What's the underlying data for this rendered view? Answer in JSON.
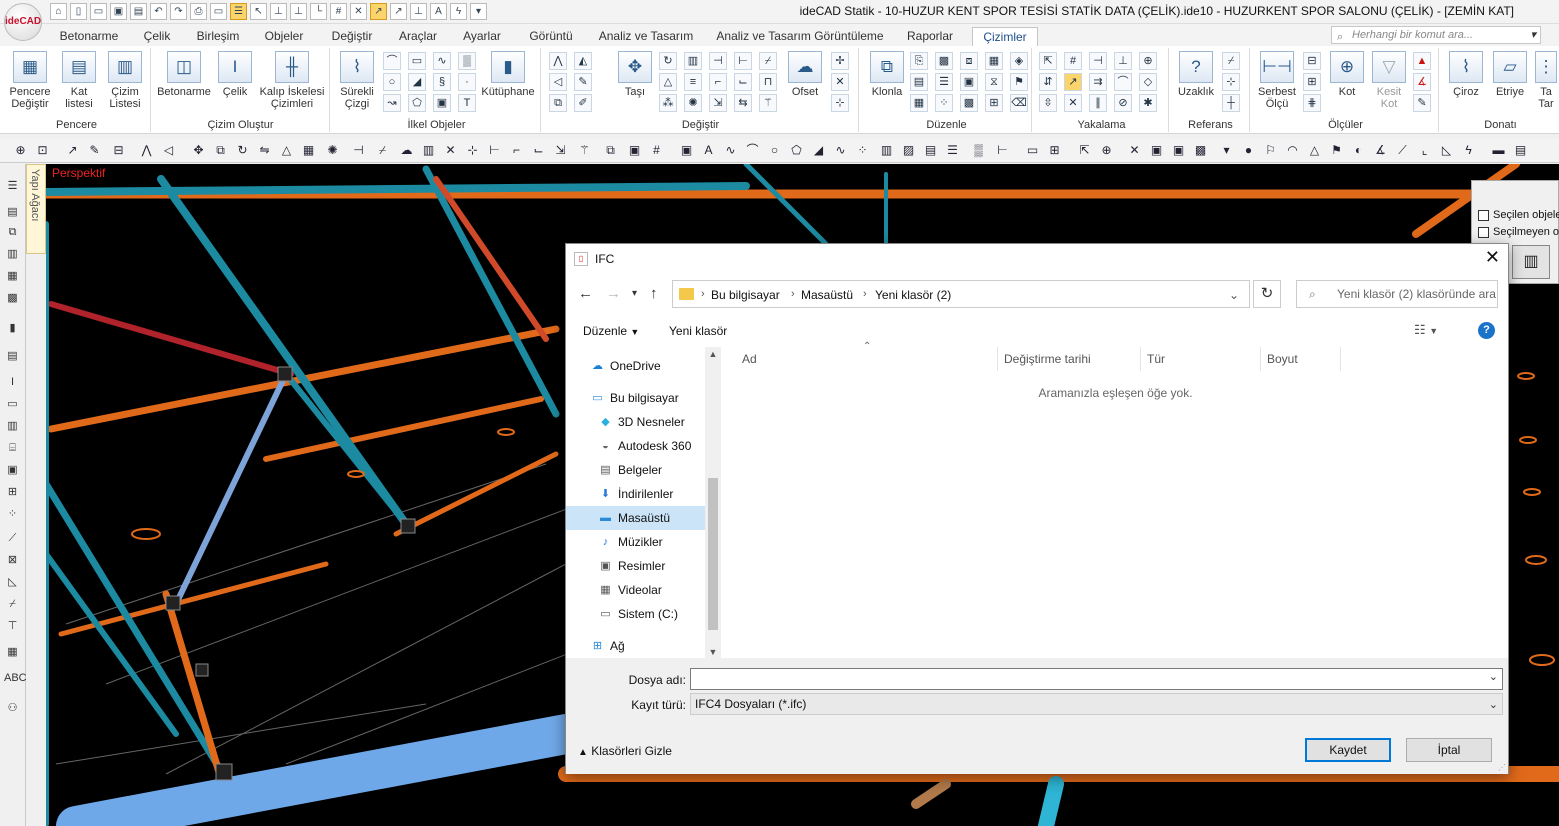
{
  "app": {
    "logo_text": "ideCAD",
    "window_title": "ideCAD Statik - 10-HUZUR KENT SPOR TESİSİ STATİK DATA (ÇELİK).ide10 - HUZURKENT SPOR SALONU (ÇELİK) - [ZEMİN KAT]"
  },
  "ribbon_tabs": [
    "Betonarme",
    "Çelik",
    "Birleşim",
    "Objeler",
    "Değiştir",
    "Araçlar",
    "Ayarlar",
    "Görüntü",
    "Analiz ve Tasarım",
    "Analiz ve Tasarım Görüntüleme",
    "Raporlar",
    "Çizimler"
  ],
  "active_tab": "Çizimler",
  "command_search_placeholder": "Herhangi bir komut ara...",
  "ribbon_groups": {
    "pencere": {
      "label": "Pencere",
      "btn1": "Pencere Değiştir",
      "btn2": "Kat listesi",
      "btn3": "Çizim Listesi"
    },
    "cizim_olustur": {
      "label": "Çizim Oluştur",
      "btn1": "Betonarme",
      "btn2": "Çelik",
      "btn3": "Kalıp İskelesi Çizimleri"
    },
    "ilkel": {
      "label": "İlkel Objeler",
      "btn1": "Sürekli Çizgi",
      "btn2": "Kütüphane"
    },
    "degistir": {
      "label": "Değiştir",
      "btn1": "Taşı",
      "btn2": "Ofset"
    },
    "duzenle": {
      "label": "Düzenle",
      "btn1": "Klonla"
    },
    "yakalama": {
      "label": "Yakalama"
    },
    "referans": {
      "label": "Referans",
      "btn1": "Uzaklık"
    },
    "olculer": {
      "label": "Ölçüler",
      "btn1": "Serbest Ölçü",
      "btn2": "Kot",
      "btn3": "Kesit Kot"
    },
    "donati": {
      "label": "Donatı",
      "btn1": "Çiroz",
      "btn2": "Etriye",
      "btn3": "Ta Tar"
    }
  },
  "side_panel_label": "Yapı Ağacı",
  "viewport_label": "Perspektif",
  "right_panel": {
    "check1": "Seçilen objeler",
    "check2": "Seçilmeyen ob"
  },
  "dialog": {
    "title": "IFC",
    "breadcrumb": [
      "Bu bilgisayar",
      "Masaüstü",
      "Yeni klasör (2)"
    ],
    "search_placeholder": "Yeni klasör (2) klasöründe ara",
    "organize": "Düzenle",
    "new_folder": "Yeni klasör",
    "nav_items": [
      {
        "label": "OneDrive",
        "icon": "cloud-icon"
      },
      {
        "label": "Bu bilgisayar",
        "icon": "computer-icon"
      },
      {
        "label": "3D Nesneler",
        "icon": "cube-icon"
      },
      {
        "label": "Autodesk 360",
        "icon": "autodesk-icon"
      },
      {
        "label": "Belgeler",
        "icon": "document-icon"
      },
      {
        "label": "İndirilenler",
        "icon": "download-icon"
      },
      {
        "label": "Masaüstü",
        "icon": "desktop-icon"
      },
      {
        "label": "Müzikler",
        "icon": "music-icon"
      },
      {
        "label": "Resimler",
        "icon": "pictures-icon"
      },
      {
        "label": "Videolar",
        "icon": "video-icon"
      },
      {
        "label": "Sistem (C:)",
        "icon": "drive-icon"
      },
      {
        "label": "Ağ",
        "icon": "network-icon"
      }
    ],
    "selected_nav": "Masaüstü",
    "columns": [
      "Ad",
      "Değiştirme tarihi",
      "Tür",
      "Boyut"
    ],
    "empty_message": "Aramanızla eşleşen öğe yok.",
    "filename_label": "Dosya adı:",
    "filename_value": "",
    "filetype_label": "Kayıt türü:",
    "filetype_value": "IFC4 Dosyaları (*.ifc)",
    "hide_folders": "Klasörleri Gizle",
    "save_button": "Kaydet",
    "cancel_button": "İptal"
  }
}
